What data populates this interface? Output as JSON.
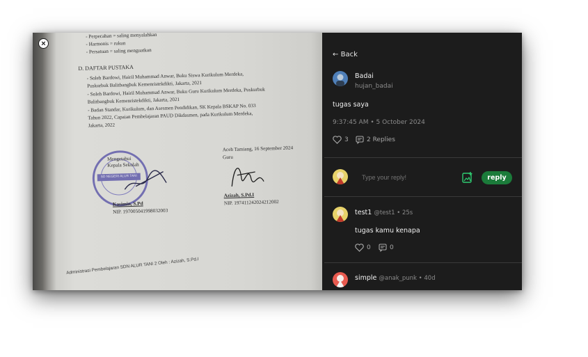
{
  "document": {
    "lines_top": [
      "-  Perpecahan = saling menyalahkan",
      "-  Harmonis = rukun",
      "-  Persatuan = saling menguatkan"
    ],
    "heading": "D.  DAFTAR PUSTAKA",
    "references": [
      "-  Soleh Bardowi, Hairil Muhammad Anwar, Buku  Siswa Kurikulum Merdeka,",
      "   Puskurbuk Balitbangbuk Kemenristekdikti, Jakarta, 2021",
      "-  Soleh Bardowi, Hairil Muhammad Anwar, Buku  Guru Kurikulum Merdeka, Puskurbuk",
      "   Balitbangbuk Kemenristekdikti, Jakarta, 2021",
      "-  Badan Standar, Kurikulum, dan Asesmen Pendidikan, SK Kepala BSKAP No. 033",
      "   Tahun 2022, Capaian Pembelajaran PAUD Dikdasmen, pada Kurikulum Merdeka,",
      "   Jakarta, 2022"
    ],
    "left_sign_role": "Mengetahui\nKepala Sekolah",
    "left_sign_name": "Kasimin, S.Pd",
    "left_sign_nip": "NIP. 197005041998032003",
    "right_sign_place_date": "Aceh Tamiang, 16 September 2024",
    "right_sign_role": "Guru",
    "right_sign_name": "Azizah, S.Pd.I",
    "right_sign_nip": "NIP. 197411242024212002",
    "stamp_text": "SD NEGERI ALUR TANI",
    "footer": "Administrasi Pembelajaran SDN ALUR TANI 2 Oleh : Azizah, S.Pd.I"
  },
  "thread": {
    "back_label": "Back",
    "post": {
      "name": "Badai",
      "handle": "hujan_badai",
      "text": "tugas saya",
      "timestamp": "9:37:45 AM • 5 October 2024",
      "likes": "3",
      "replies": "2 Replies"
    },
    "reply_box": {
      "placeholder": "Type your reply!",
      "button_label": "reply"
    },
    "comments": [
      {
        "name": "test1",
        "meta": "@test1 • 25s",
        "text": "tugas kamu kenapa",
        "likes": "0",
        "replies": "0"
      },
      {
        "name": "simple",
        "meta": "@anak_punk • 40d"
      }
    ]
  },
  "colors": {
    "panel_bg": "#1c1c1c",
    "reply_button": "#1b7b3a",
    "attach_icon": "#2ecc71",
    "stamp": "#5a55a8"
  }
}
